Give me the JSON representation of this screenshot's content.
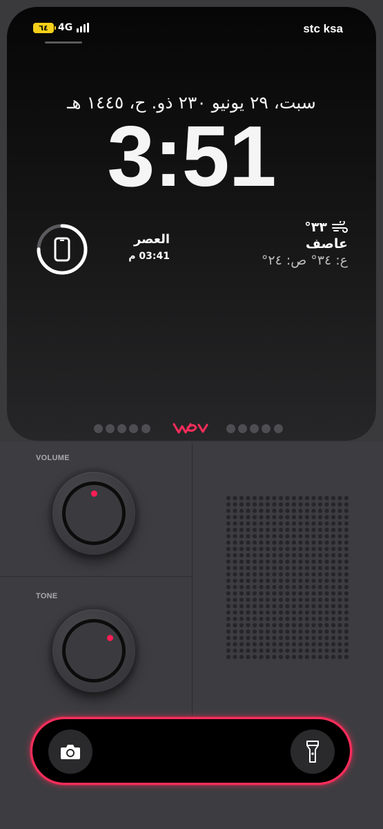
{
  "status_bar": {
    "battery": "٦٤",
    "network": "4G",
    "carrier": "stc ksa"
  },
  "lock_screen": {
    "date": "سبت، ٢٩ يونيو ٢٣٠ ذو. ح، ١٤٤٥ هـ",
    "time": "3:51"
  },
  "widgets": {
    "battery_ring": {
      "icon": "phone-icon",
      "level": 0.75
    },
    "prayer": {
      "name": "العصر",
      "time": "03:41 م"
    },
    "weather": {
      "icon": "wind-icon",
      "temperature": "٣٣°",
      "condition": "عاصف",
      "high_low": "ع: ٣٤° ص: ٢٤°"
    }
  },
  "page_dots": {
    "left_count": 5,
    "right_count": 5
  },
  "controls": {
    "volume_label": "VOLUME",
    "tone_label": "TONE"
  },
  "action_bar": {
    "left_icon": "camera-icon",
    "right_icon": "flashlight-icon"
  },
  "colors": {
    "accent": "#ff2d5b",
    "battery": "#f4cf1a",
    "ring": "#ffffff"
  }
}
